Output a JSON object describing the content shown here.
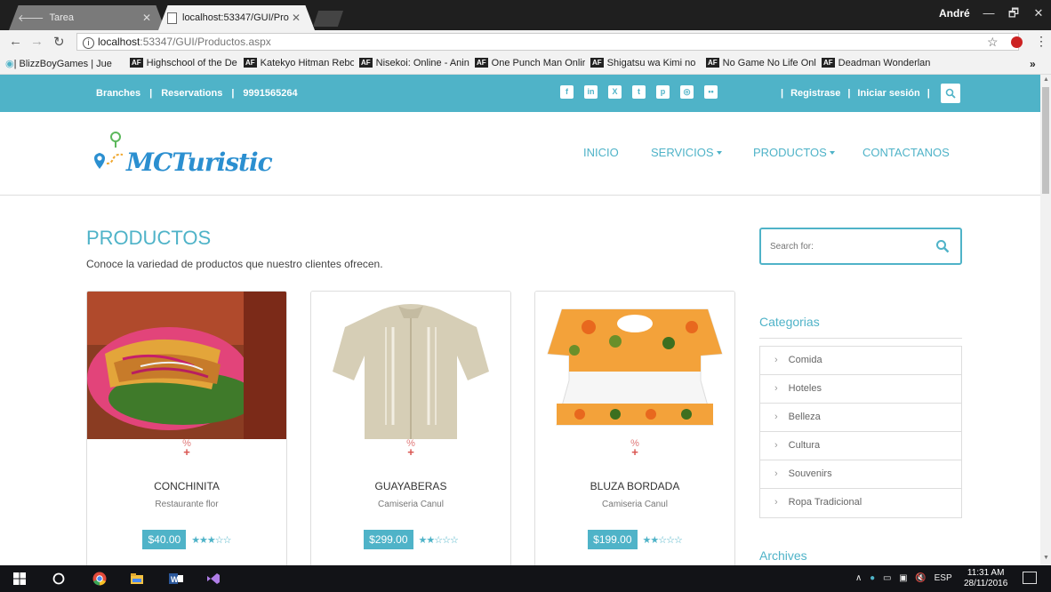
{
  "browser": {
    "tabs": [
      {
        "label": "Tarea",
        "active": false
      },
      {
        "label": "localhost:53347/GUI/Pro",
        "active": true
      }
    ],
    "user": "André",
    "window_buttons": [
      "—",
      "🗗",
      "✕"
    ],
    "url_host": "localhost",
    "url_path": ":53347/GUI/Productos.aspx",
    "bookmarks": [
      "| BlizzBoyGames | Jue",
      "Highschool of the De",
      "Katekyo Hitman Rebo",
      "Nisekoi: Online - Anin",
      "One Punch Man Onlir",
      "Shigatsu wa Kimi no",
      "No Game No Life Onl",
      "Deadman Wonderlan"
    ],
    "bookmarks_more": "»"
  },
  "topbar": {
    "branches": "Branches",
    "reservations": "Reservations",
    "phone": "9991565264",
    "register": "Registrase",
    "login": "Iniciar sesión",
    "socials": [
      "facebook-icon",
      "linkedin-icon",
      "xing-icon",
      "twitter-icon",
      "pinterest-icon",
      "instagram-icon",
      "flickr-icon"
    ]
  },
  "header": {
    "logo_text": "MCTuristic",
    "nav": [
      "INICIO",
      "SERVICIOS",
      "PRODUCTOS",
      "CONTACTANOS"
    ]
  },
  "main": {
    "title": "PRODUCTOS",
    "subtitle": "Conoce la variedad de productos que nuestro clientes ofrecen.",
    "products": [
      {
        "name": "CONCHINITA",
        "vendor": "Restaurante flor",
        "price": "$40.00",
        "rating": 3,
        "max": 5
      },
      {
        "name": "GUAYABERAS",
        "vendor": "Camiseria Canul",
        "price": "$299.00",
        "rating": 2,
        "max": 5
      },
      {
        "name": "BLUZA BORDADA",
        "vendor": "Camiseria Canul",
        "price": "$199.00",
        "rating": 2,
        "max": 5
      }
    ]
  },
  "sidebar": {
    "search_placeholder": "Search for:",
    "categories_title": "Categorias",
    "categories": [
      "Comida",
      "Hoteles",
      "Belleza",
      "Cultura",
      "Souvenirs",
      "Ropa Tradicional"
    ],
    "archives_title": "Archives"
  },
  "taskbar": {
    "lang": "ESP",
    "time": "11:31 AM",
    "date": "28/11/2016"
  },
  "colors": {
    "accent": "#4fb3c8",
    "link_red": "#d9534f"
  }
}
